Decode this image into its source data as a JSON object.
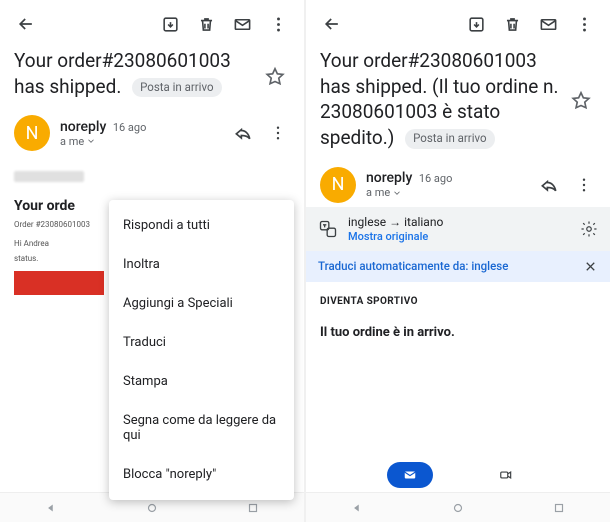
{
  "left": {
    "subject": "Your order#23080601003        has shipped.",
    "inbox_label": "Posta in arrivo",
    "sender_name": "noreply",
    "date": "16 ago",
    "to_me": "a me",
    "avatar_letter": "N",
    "body_title": "Your orde",
    "body_meta": "Order #23080601003",
    "body_greeting": "Hi Andrea",
    "body_status": "status.",
    "menu": {
      "reply_all": "Rispondi a tutti",
      "forward": "Inoltra",
      "add_star": "Aggiungi a Speciali",
      "translate": "Traduci",
      "print": "Stampa",
      "mark_unread": "Segna come da leggere da qui",
      "block": "Blocca \"noreply\""
    }
  },
  "right": {
    "subject": "Your order#23080601003 has shipped. (Il tuo ordine n. 23080601003     è stato spedito.)",
    "inbox_label": "Posta in arrivo",
    "sender_name": "noreply",
    "date": "16 ago",
    "to_me": "a me",
    "avatar_letter": "N",
    "translate": {
      "from_lang": "inglese",
      "to_lang": "italiano",
      "show_original": "Mostra originale",
      "auto_text": "Traduci automaticamente da: inglese"
    },
    "content": {
      "header": "DIVENTA SPORTIVO",
      "main_line": "Il tuo ordine è in arrivo."
    }
  }
}
